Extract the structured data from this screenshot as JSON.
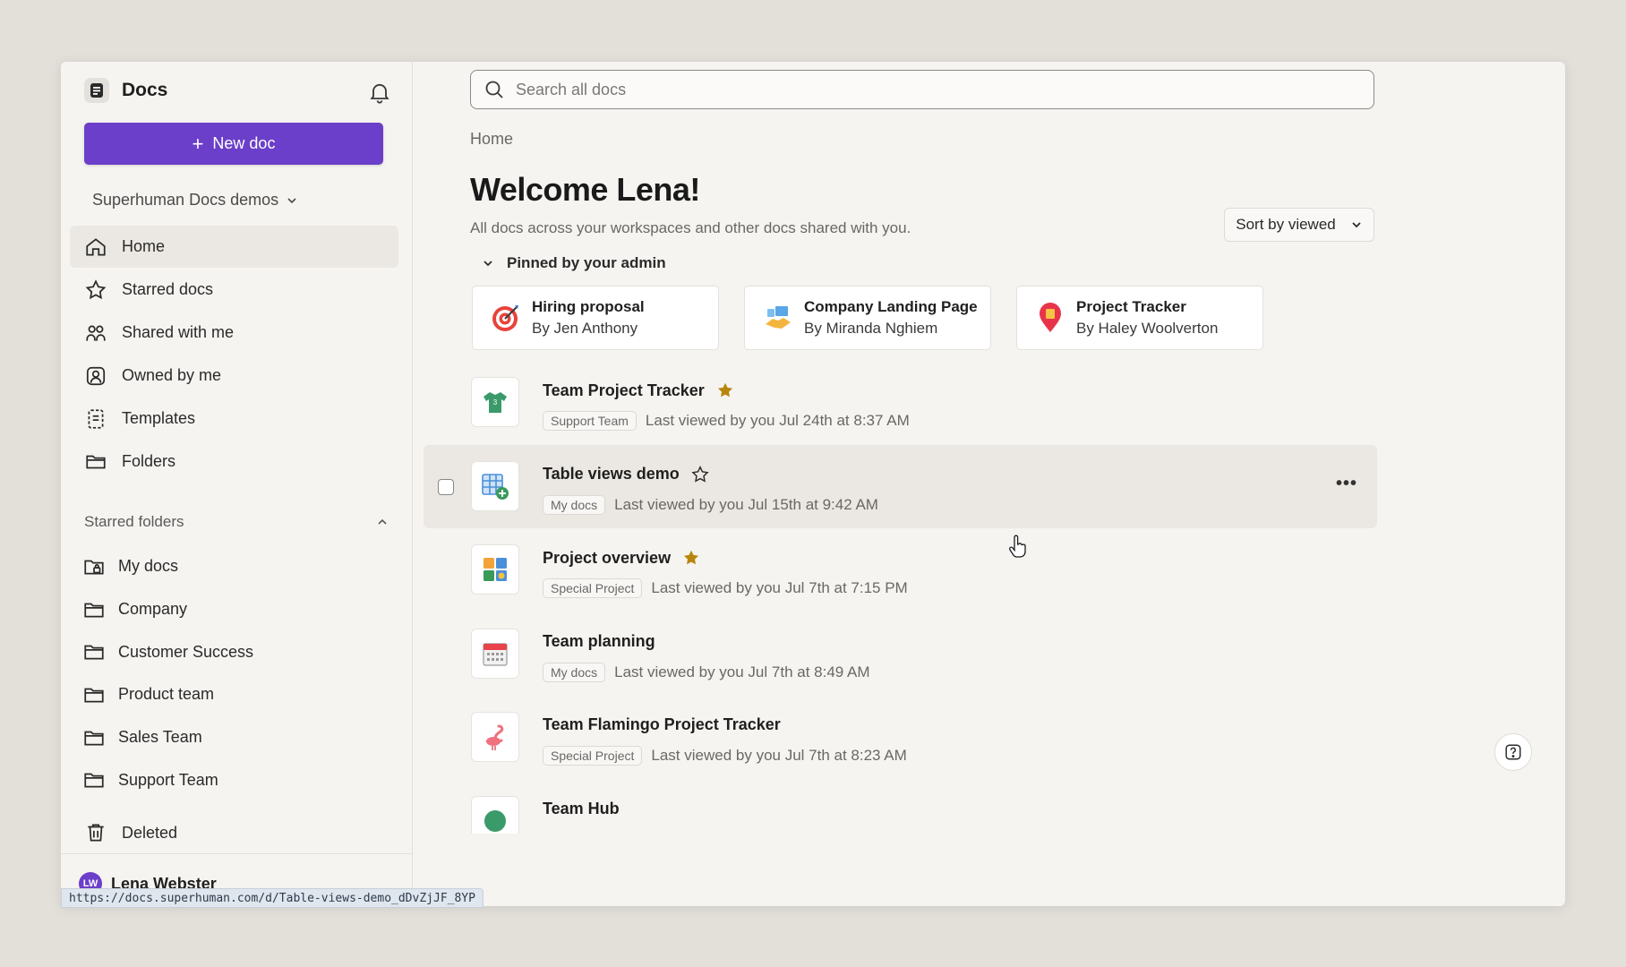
{
  "sidebar": {
    "brand_title": "Docs",
    "new_doc_label": "New doc",
    "workspace_name": "Superhuman Docs demos",
    "nav": [
      {
        "label": "Home",
        "icon": "home-icon",
        "active": true
      },
      {
        "label": "Starred docs",
        "icon": "star-icon"
      },
      {
        "label": "Shared with me",
        "icon": "people-icon"
      },
      {
        "label": "Owned by me",
        "icon": "user-square-icon"
      },
      {
        "label": "Templates",
        "icon": "template-icon"
      },
      {
        "label": "Folders",
        "icon": "folder-open-icon"
      }
    ],
    "starred_folders_label": "Starred folders",
    "folders": [
      {
        "label": "My docs",
        "icon": "folder-lock-icon"
      },
      {
        "label": "Company",
        "icon": "folder-icon"
      },
      {
        "label": "Customer Success",
        "icon": "folder-icon"
      },
      {
        "label": "Product team",
        "icon": "folder-icon"
      },
      {
        "label": "Sales Team",
        "icon": "folder-icon"
      },
      {
        "label": "Support Team",
        "icon": "folder-icon"
      }
    ],
    "deleted_label": "Deleted",
    "user": {
      "name": "Lena Webster",
      "initials": "LW"
    }
  },
  "main": {
    "search_placeholder": "Search all docs",
    "breadcrumb": "Home",
    "title": "Welcome Lena!",
    "subtitle": "All docs across your workspaces and other docs shared with you.",
    "sort_label": "Sort by viewed",
    "pinned_label": "Pinned by your admin",
    "pinned": [
      {
        "title": "Hiring proposal",
        "author": "By Jen Anthony",
        "icon": "target-icon"
      },
      {
        "title": "Company Landing Page",
        "author": "By Miranda Nghiem",
        "icon": "handshake-icon"
      },
      {
        "title": "Project Tracker",
        "author": "By Haley Woolverton",
        "icon": "map-pin-icon"
      }
    ],
    "docs": [
      {
        "title": "Team Project Tracker",
        "starred": true,
        "tag": "Support Team",
        "viewed": "Last viewed by you Jul 24th at 8:37 AM",
        "icon": "shirt-icon"
      },
      {
        "title": "Table views demo",
        "starred": false,
        "tag": "My docs",
        "viewed": "Last viewed by you Jul 15th at 9:42 AM",
        "icon": "table-add-icon",
        "hover": true
      },
      {
        "title": "Project overview",
        "starred": true,
        "tag": "Special Project",
        "viewed": "Last viewed by you Jul 7th at 7:15 PM",
        "icon": "grid-icon"
      },
      {
        "title": "Team planning",
        "starred": false,
        "tag": "My docs",
        "viewed": "Last viewed by you Jul 7th at 8:49 AM",
        "icon": "calendar-icon"
      },
      {
        "title": "Team Flamingo Project Tracker",
        "starred": false,
        "tag": "Special Project",
        "viewed": "Last viewed by you Jul 7th at 8:23 AM",
        "icon": "flamingo-icon"
      },
      {
        "title": "Team Hub",
        "starred": false,
        "tag": "",
        "viewed": "",
        "icon": "hub-icon"
      }
    ]
  },
  "status_url": "https://docs.superhuman.com/d/Table-views-demo_dDvZjJF_8YP",
  "colors": {
    "accent": "#6b3fc9",
    "star": "#b8860b"
  }
}
